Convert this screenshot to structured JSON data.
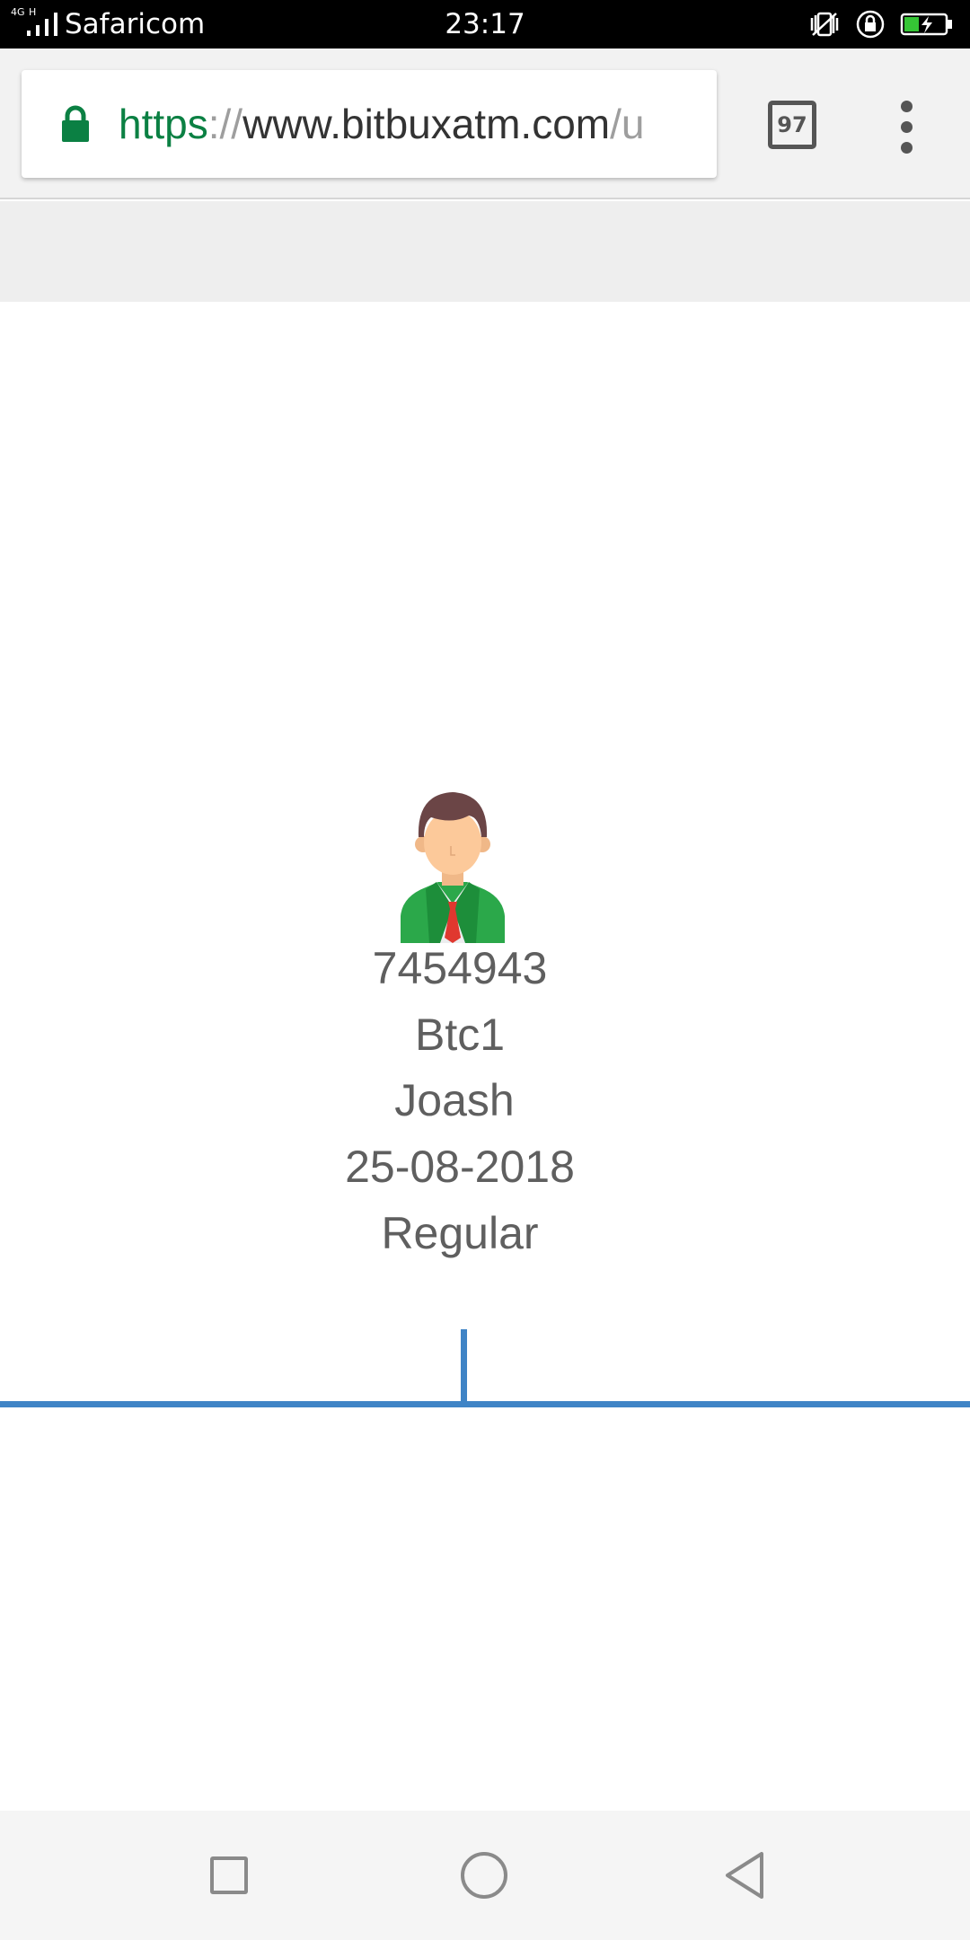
{
  "status_bar": {
    "carrier": "Safaricom",
    "time": "23:17",
    "signal_tags": [
      "4G",
      "H"
    ],
    "icons": [
      "signal-icon",
      "vibrate-mute-icon",
      "rotation-lock-icon",
      "battery-charging-icon"
    ]
  },
  "browser": {
    "url": {
      "scheme": "https",
      "separator": "://",
      "host": "www.bitbuxatm.com",
      "path": "/u"
    },
    "tab_count": "97",
    "icons": [
      "lock-icon",
      "tab-switcher-icon",
      "more-vert-icon"
    ]
  },
  "profile": {
    "avatar_icon": "businessman-avatar-icon",
    "id": "7454943",
    "plan": "Btc1",
    "name": "Joash",
    "date": "25-08-2018",
    "type": "Regular"
  },
  "nav_bar": {
    "icons": [
      "recent-apps-icon",
      "home-icon",
      "back-icon"
    ]
  },
  "colors": {
    "accent_blue": "#3f84c6",
    "secure_green": "#0b8043",
    "text_gray": "#5f5f5f"
  }
}
